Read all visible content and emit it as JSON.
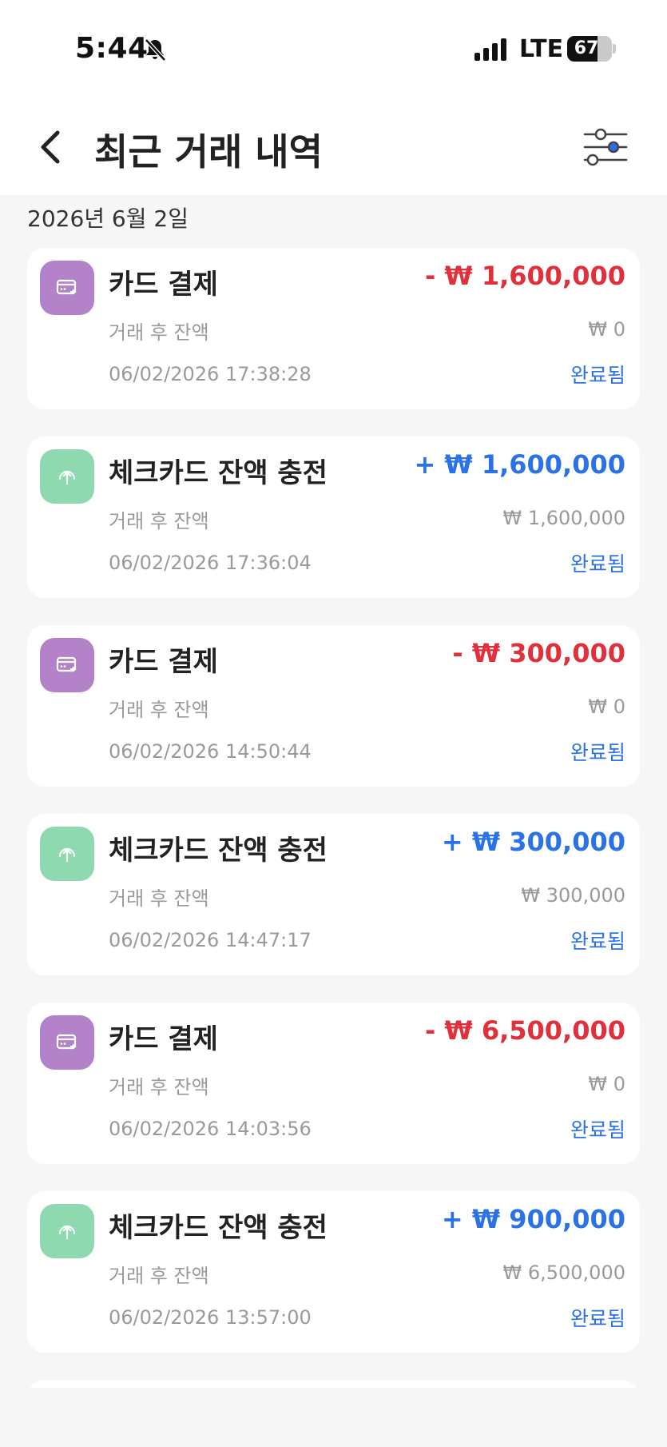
{
  "status_bar": {
    "time": "5:44",
    "network": "LTE",
    "battery_level": "67",
    "battery_fraction": 0.67,
    "icons": [
      "bell-slash-icon",
      "signal-icon",
      "battery-icon"
    ]
  },
  "header": {
    "title": "최근 거래 내역",
    "back_icon": "chevron-left-icon",
    "filter_icon": "sliders-icon"
  },
  "colors": {
    "debit": "#e0303c",
    "credit": "#2a72e6",
    "status": "#2a72e6",
    "payment_icon_bg": "#b382c8",
    "charge_icon_bg": "#8fd9b1"
  },
  "date_heading": "2026년 6월 2일",
  "transactions": [
    {
      "type": "payment",
      "title": "카드 결제",
      "amount": "- ₩ 1,600,000",
      "balance_label": "거래 후 잔액",
      "balance": "₩ 0",
      "datetime": "06/02/2026 17:38:28",
      "status": "완료됨"
    },
    {
      "type": "charge",
      "title": "체크카드 잔액 충전",
      "amount": "+ ₩ 1,600,000",
      "balance_label": "거래 후 잔액",
      "balance": "₩ 1,600,000",
      "datetime": "06/02/2026 17:36:04",
      "status": "완료됨"
    },
    {
      "type": "payment",
      "title": "카드 결제",
      "amount": "- ₩ 300,000",
      "balance_label": "거래 후 잔액",
      "balance": "₩ 0",
      "datetime": "06/02/2026 14:50:44",
      "status": "완료됨"
    },
    {
      "type": "charge",
      "title": "체크카드 잔액 충전",
      "amount": "+ ₩ 300,000",
      "balance_label": "거래 후 잔액",
      "balance": "₩ 300,000",
      "datetime": "06/02/2026 14:47:17",
      "status": "완료됨"
    },
    {
      "type": "payment",
      "title": "카드 결제",
      "amount": "- ₩ 6,500,000",
      "balance_label": "거래 후 잔액",
      "balance": "₩ 0",
      "datetime": "06/02/2026 14:03:56",
      "status": "완료됨"
    },
    {
      "type": "charge",
      "title": "체크카드 잔액 충전",
      "amount": "+ ₩ 900,000",
      "balance_label": "거래 후 잔액",
      "balance": "₩ 6,500,000",
      "datetime": "06/02/2026 13:57:00",
      "status": "완료됨"
    }
  ]
}
